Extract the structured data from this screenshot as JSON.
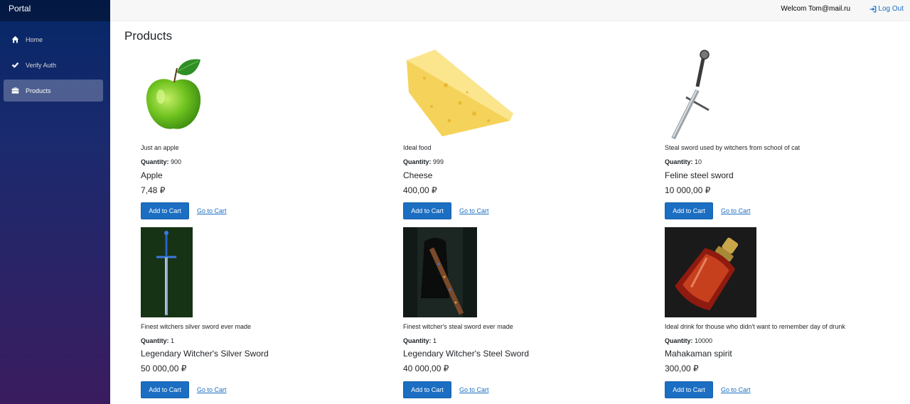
{
  "brand": "Portal",
  "nav": [
    {
      "label": "Home",
      "icon": "home-icon"
    },
    {
      "label": "Verify Auth",
      "icon": "check-icon"
    },
    {
      "label": "Products",
      "icon": "briefcase-icon",
      "active": true
    }
  ],
  "header": {
    "welcome": "Welcom Tom@mail.ru",
    "logout": "Log Out"
  },
  "page_title": "Products",
  "quantity_label": "Quantity:",
  "add_to_cart": "Add to Cart",
  "go_to_cart": "Go to Cart",
  "products": [
    {
      "description": "Just an apple",
      "quantity": "900",
      "name": "Apple",
      "price": "7,48 ₽",
      "image": "apple"
    },
    {
      "description": "Ideal food",
      "quantity": "999",
      "name": "Cheese",
      "price": "400,00 ₽",
      "image": "cheese"
    },
    {
      "description": "Steal sword used by witchers from school of cat",
      "quantity": "10",
      "name": "Feline steel sword",
      "price": "10 000,00 ₽",
      "image": "steel-sword"
    },
    {
      "description": "Finest witchers silver sword ever made",
      "quantity": "1",
      "name": "Legendary Witcher's Silver Sword",
      "price": "50 000,00 ₽",
      "image": "silver-sword"
    },
    {
      "description": "Finest witcher's steal sword ever made",
      "quantity": "1",
      "name": "Legendary Witcher's Steel Sword",
      "price": "40 000,00 ₽",
      "image": "witcher-steel-sword"
    },
    {
      "description": "Ideal drink for thouse who didn't want to remember day of drunk",
      "quantity": "10000",
      "name": "Mahakaman spirit",
      "price": "300,00 ₽",
      "image": "spirit-bottle"
    }
  ],
  "colors": {
    "accent": "#1b6ec2",
    "sidebar_top": "#052767",
    "sidebar_bottom": "#3a1c5f"
  }
}
